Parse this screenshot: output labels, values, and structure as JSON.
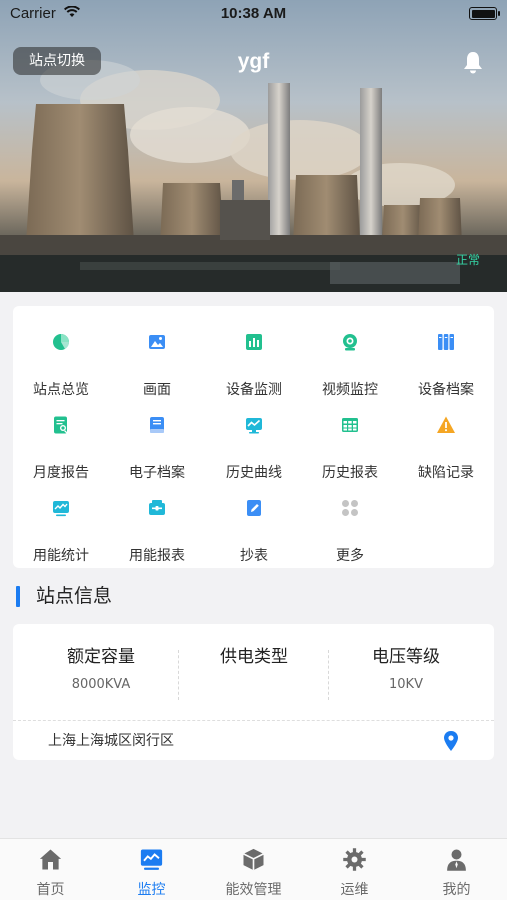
{
  "status_bar": {
    "carrier": "Carrier",
    "time": "10:38 AM"
  },
  "hero": {
    "switch_label": "站点切换",
    "title": "ygf",
    "status": "正常"
  },
  "grid": {
    "items": [
      {
        "label": "站点总览",
        "icon": "pie-chart-icon",
        "color": "#22c08f"
      },
      {
        "label": "画面",
        "icon": "picture-icon",
        "color": "#3b8ef5"
      },
      {
        "label": "设备监测",
        "icon": "bar-chart-icon",
        "color": "#22c08f"
      },
      {
        "label": "视频监控",
        "icon": "camera-icon",
        "color": "#22c08f"
      },
      {
        "label": "设备档案",
        "icon": "archive-icon",
        "color": "#3b8ef5"
      },
      {
        "label": "月度报告",
        "icon": "report-search-icon",
        "color": "#22c08f"
      },
      {
        "label": "电子档案",
        "icon": "book-icon",
        "color": "#3b8ef5"
      },
      {
        "label": "历史曲线",
        "icon": "line-chart-icon",
        "color": "#20b8d8"
      },
      {
        "label": "历史报表",
        "icon": "table-icon",
        "color": "#22c08f"
      },
      {
        "label": "缺陷记录",
        "icon": "warning-icon",
        "color": "#f5a623"
      },
      {
        "label": "用能统计",
        "icon": "trend-icon",
        "color": "#20b8d8"
      },
      {
        "label": "用能报表",
        "icon": "box-report-icon",
        "color": "#20b8d8"
      },
      {
        "label": "抄表",
        "icon": "edit-icon",
        "color": "#3b8ef5"
      },
      {
        "label": "更多",
        "icon": "more-icon",
        "color": "#c4c4c4"
      }
    ]
  },
  "section": {
    "title": "站点信息"
  },
  "info": {
    "columns": [
      {
        "name": "额定容量",
        "value": "8000KVA"
      },
      {
        "name": "供电类型",
        "value": ""
      },
      {
        "name": "电压等级",
        "value": "10KV"
      }
    ],
    "address": "上海上海城区闵行区"
  },
  "tabbar": {
    "active": 1,
    "items": [
      {
        "label": "首页",
        "icon": "home-icon"
      },
      {
        "label": "监控",
        "icon": "monitor-icon"
      },
      {
        "label": "能效管理",
        "icon": "cube-icon"
      },
      {
        "label": "运维",
        "icon": "gear-icon"
      },
      {
        "label": "我的",
        "icon": "user-icon"
      }
    ]
  },
  "colors": {
    "accent": "#1b7cf1",
    "status_ok": "#35d6a6"
  }
}
